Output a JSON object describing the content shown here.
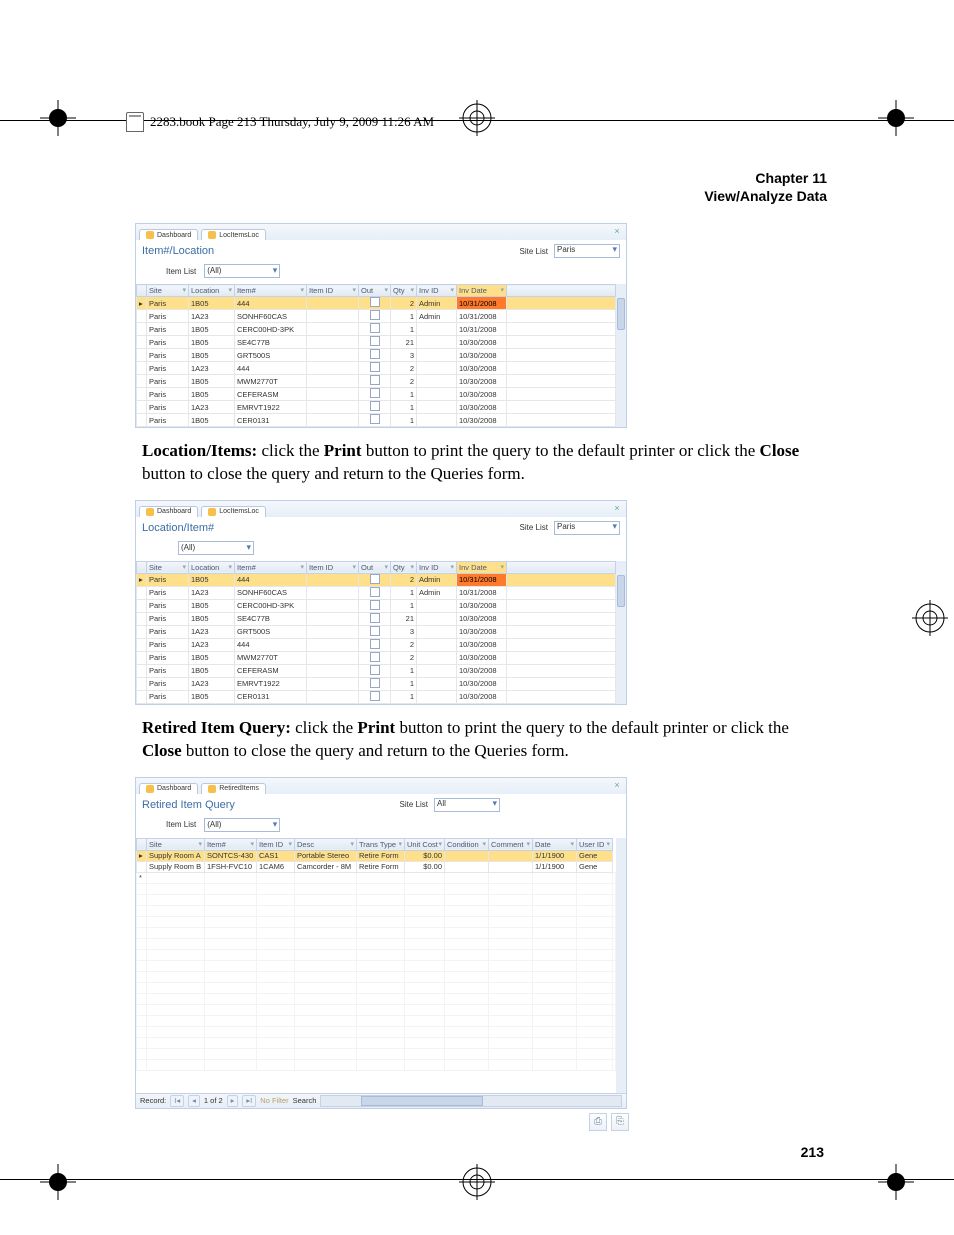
{
  "page": {
    "book_info": "2283.book  Page 213  Thursday, July 9, 2009  11:26 AM",
    "chapter_label": "Chapter 11",
    "chapter_title": "View/Analyze Data",
    "page_number": "213"
  },
  "paragraphs": {
    "p1_lead": "Location/Items:",
    "p1_a": " click the ",
    "p1_print": "Print",
    "p1_b": " button to print the query to the default printer or click the ",
    "p1_close": "Close",
    "p1_c": " button to close the query and return to the Queries form.",
    "p2_lead": "Retired Item Query:",
    "p2_a": " click the ",
    "p2_print": "Print",
    "p2_b": " button to print the query to the default printer or click the ",
    "p2_close": "Close",
    "p2_c": " button to close the query and return to the Queries form."
  },
  "common": {
    "dashboard_tab": "Dashboard",
    "site_list_label": "Site List",
    "item_list_label": "Item List",
    "filter_all": "(All)",
    "site_value": "Paris",
    "all_value": "All"
  },
  "shot1": {
    "tab": "LocItemsLoc",
    "title": "Item#/Location",
    "headers": [
      "Site",
      "Location",
      "Item#",
      "Item ID",
      "Out",
      "Qty",
      "Inv ID",
      "Inv Date"
    ],
    "rows": [
      {
        "site": "Paris",
        "loc": "1B05",
        "item": "444",
        "id": "",
        "qty": "2",
        "inv": "Admin",
        "date": "10/31/2008",
        "sel": true
      },
      {
        "site": "Paris",
        "loc": "1A23",
        "item": "SONHF60CAS",
        "id": "",
        "qty": "1",
        "inv": "Admin",
        "date": "10/31/2008"
      },
      {
        "site": "Paris",
        "loc": "1B05",
        "item": "CERC00HD-3PK",
        "id": "",
        "qty": "1",
        "inv": "",
        "date": "10/31/2008"
      },
      {
        "site": "Paris",
        "loc": "1B05",
        "item": "SE4C77B",
        "id": "",
        "qty": "21",
        "inv": "",
        "date": "10/30/2008"
      },
      {
        "site": "Paris",
        "loc": "1B05",
        "item": "GRT500S",
        "id": "",
        "qty": "3",
        "inv": "",
        "date": "10/30/2008"
      },
      {
        "site": "Paris",
        "loc": "1A23",
        "item": "444",
        "id": "",
        "qty": "2",
        "inv": "",
        "date": "10/30/2008"
      },
      {
        "site": "Paris",
        "loc": "1B05",
        "item": "MWM2770T",
        "id": "",
        "qty": "2",
        "inv": "",
        "date": "10/30/2008"
      },
      {
        "site": "Paris",
        "loc": "1B05",
        "item": "CEFERASM",
        "id": "",
        "qty": "1",
        "inv": "",
        "date": "10/30/2008"
      },
      {
        "site": "Paris",
        "loc": "1A23",
        "item": "EMRVT1922",
        "id": "",
        "qty": "1",
        "inv": "",
        "date": "10/30/2008"
      },
      {
        "site": "Paris",
        "loc": "1B05",
        "item": "CER0131",
        "id": "",
        "qty": "1",
        "inv": "",
        "date": "10/30/2008"
      }
    ]
  },
  "shot2": {
    "tab": "LocItemsLoc",
    "title": "Location/Item#",
    "headers": [
      "Site",
      "Location",
      "Item#",
      "Item ID",
      "Out",
      "Qty",
      "Inv ID",
      "Inv Date"
    ],
    "rows": [
      {
        "site": "Paris",
        "loc": "1B05",
        "item": "444",
        "id": "",
        "qty": "2",
        "inv": "Admin",
        "date": "10/31/2008",
        "sel": true
      },
      {
        "site": "Paris",
        "loc": "1A23",
        "item": "SONHF60CAS",
        "id": "",
        "qty": "1",
        "inv": "Admin",
        "date": "10/31/2008"
      },
      {
        "site": "Paris",
        "loc": "1B05",
        "item": "CERC00HD-3PK",
        "id": "",
        "qty": "1",
        "inv": "",
        "date": "10/30/2008"
      },
      {
        "site": "Paris",
        "loc": "1B05",
        "item": "SE4C77B",
        "id": "",
        "qty": "21",
        "inv": "",
        "date": "10/30/2008"
      },
      {
        "site": "Paris",
        "loc": "1A23",
        "item": "GRT500S",
        "id": "",
        "qty": "3",
        "inv": "",
        "date": "10/30/2008"
      },
      {
        "site": "Paris",
        "loc": "1A23",
        "item": "444",
        "id": "",
        "qty": "2",
        "inv": "",
        "date": "10/30/2008"
      },
      {
        "site": "Paris",
        "loc": "1B05",
        "item": "MWM2770T",
        "id": "",
        "qty": "2",
        "inv": "",
        "date": "10/30/2008"
      },
      {
        "site": "Paris",
        "loc": "1B05",
        "item": "CEFERASM",
        "id": "",
        "qty": "1",
        "inv": "",
        "date": "10/30/2008"
      },
      {
        "site": "Paris",
        "loc": "1A23",
        "item": "EMRVT1922",
        "id": "",
        "qty": "1",
        "inv": "",
        "date": "10/30/2008"
      },
      {
        "site": "Paris",
        "loc": "1B05",
        "item": "CER0131",
        "id": "",
        "qty": "1",
        "inv": "",
        "date": "10/30/2008"
      }
    ]
  },
  "shot3": {
    "tab": "RetiredItems",
    "title": "Retired Item Query",
    "headers": [
      "Site",
      "Item#",
      "Item ID",
      "Desc",
      "Trans Type",
      "Unit Cost",
      "Condition",
      "Comment",
      "Date",
      "User ID"
    ],
    "rows": [
      {
        "site": "Supply Room A",
        "item": "SONTCS-430",
        "id": "CAS1",
        "desc": "Portable Stereo",
        "ttype": "Retire Form",
        "cost": "$0.00",
        "cond": "",
        "comment": "",
        "date": "1/1/1900",
        "user": "Gene",
        "sel": true
      },
      {
        "site": "Supply Room B",
        "item": "1FSH-FVC10",
        "id": "1CAM6",
        "desc": "Camcorder - 8M",
        "ttype": "Retire Form",
        "cost": "$0.00",
        "cond": "",
        "comment": "",
        "date": "1/1/1900",
        "user": "Gene"
      }
    ],
    "record_bar": {
      "label": "Record:",
      "pos": "1 of 2",
      "nav_first": "I◂",
      "nav_prev": "◂",
      "nav_next": "▸",
      "nav_last": "▸I",
      "nofilter": "No Filter",
      "search": "Search"
    }
  }
}
